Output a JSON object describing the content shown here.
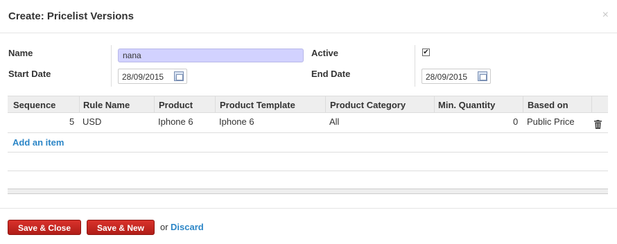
{
  "dialog": {
    "title": "Create: Pricelist Versions",
    "close_glyph": "×"
  },
  "form": {
    "name_label": "Name",
    "name_value": "nana",
    "active_label": "Active",
    "active_checked": true,
    "start_date_label": "Start Date",
    "start_date_value": "28/09/2015",
    "end_date_label": "End Date",
    "end_date_value": "28/09/2015"
  },
  "grid": {
    "columns": [
      "Sequence",
      "Rule Name",
      "Product",
      "Product Template",
      "Product Category",
      "Min. Quantity",
      "Based on"
    ],
    "rows": [
      {
        "sequence": "5",
        "rule_name": "USD",
        "product": "Iphone 6",
        "product_template": "Iphone 6",
        "product_category": "All",
        "min_quantity": "0",
        "based_on": "Public Price"
      }
    ],
    "add_item_label": "Add an item"
  },
  "footer": {
    "save_close_label": "Save & Close",
    "save_new_label": "Save & New",
    "or_label": "or",
    "discard_label": "Discard"
  },
  "icons": {
    "calendar": "calendar-icon",
    "trash": "trash-icon",
    "close": "close-icon",
    "checkbox": "checkbox-icon"
  },
  "colors": {
    "primary_button": "#c9302c",
    "link": "#2c86c7",
    "name_field_bg": "#d2d2ff",
    "grid_header_bg": "#eeeeee"
  }
}
